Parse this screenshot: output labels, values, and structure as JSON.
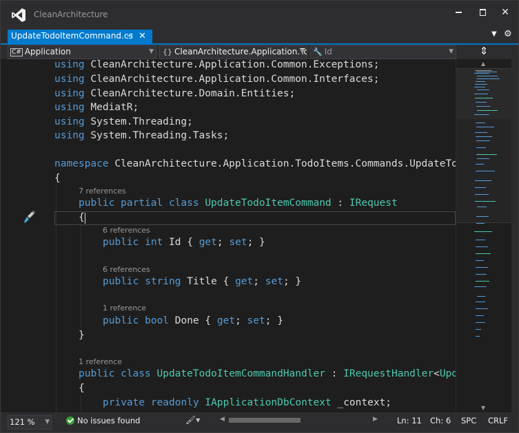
{
  "window": {
    "title": "CleanArchitecture",
    "minimize_label": "▬",
    "maximize_label": "☐",
    "close_label": "✕"
  },
  "tab": {
    "label": "UpdateTodoItemCommand.cs",
    "pin_label": "⊣",
    "close_label": "✕"
  },
  "navbar": {
    "project": "Application",
    "type": "CleanArchitecture.Application.Todo",
    "member": "Id",
    "split_label": "⇕"
  },
  "code": {
    "lines": [
      [
        "using ",
        "CleanArchitecture.Application.Common.Exceptions;"
      ],
      [
        "using ",
        "CleanArchitecture.Application.Common.Interfaces;"
      ],
      [
        "using ",
        "CleanArchitecture.Domain.Entities;"
      ],
      [
        "using ",
        "MediatR;"
      ],
      [
        "using ",
        "System.Threading;"
      ],
      [
        "using ",
        "System.Threading.Tasks;"
      ]
    ],
    "namespace_kw": "namespace ",
    "namespace_name": "CleanArchitecture.Application.TodoItems.Commands.UpdateTodo",
    "brace_open": "{",
    "brace_close": "}",
    "class_refs": "7 references",
    "class_kw": "public partial class ",
    "class_name": "UpdateTodoItemCommand",
    "class_sep": " : ",
    "class_base": "IRequest",
    "id_refs": "6 references",
    "id_mod": "public int ",
    "id_name": "Id { ",
    "get_kw": "get",
    "set_kw": "set",
    "accessor_sep": "; ",
    "accessor_end": "; }",
    "title_refs": "6 references",
    "title_mod": "public string ",
    "title_name": "Title { ",
    "done_refs": "1 reference",
    "done_mod": "public bool ",
    "done_name": "Done { ",
    "handler_refs": "1 reference",
    "handler_kw": "public class ",
    "handler_name": "UpdateTodoItemCommandHandler",
    "handler_sep": " : ",
    "handler_base": "IRequestHandler",
    "handler_generic": "<",
    "handler_generic_arg": "Upda",
    "field_kw": "private readonly ",
    "field_type": "IApplicationDbContext",
    "field_name": " _context;"
  },
  "status": {
    "zoom": "121 %",
    "issues": "No issues found",
    "line": "Ln: 11",
    "col": "Ch: 6",
    "spc": "SPC",
    "eol": "CRLF"
  },
  "colors": {
    "accent": "#007acc",
    "keyword": "#569cd6",
    "type": "#4ec9b0",
    "text": "#dcdcdc",
    "lens": "#999999"
  }
}
